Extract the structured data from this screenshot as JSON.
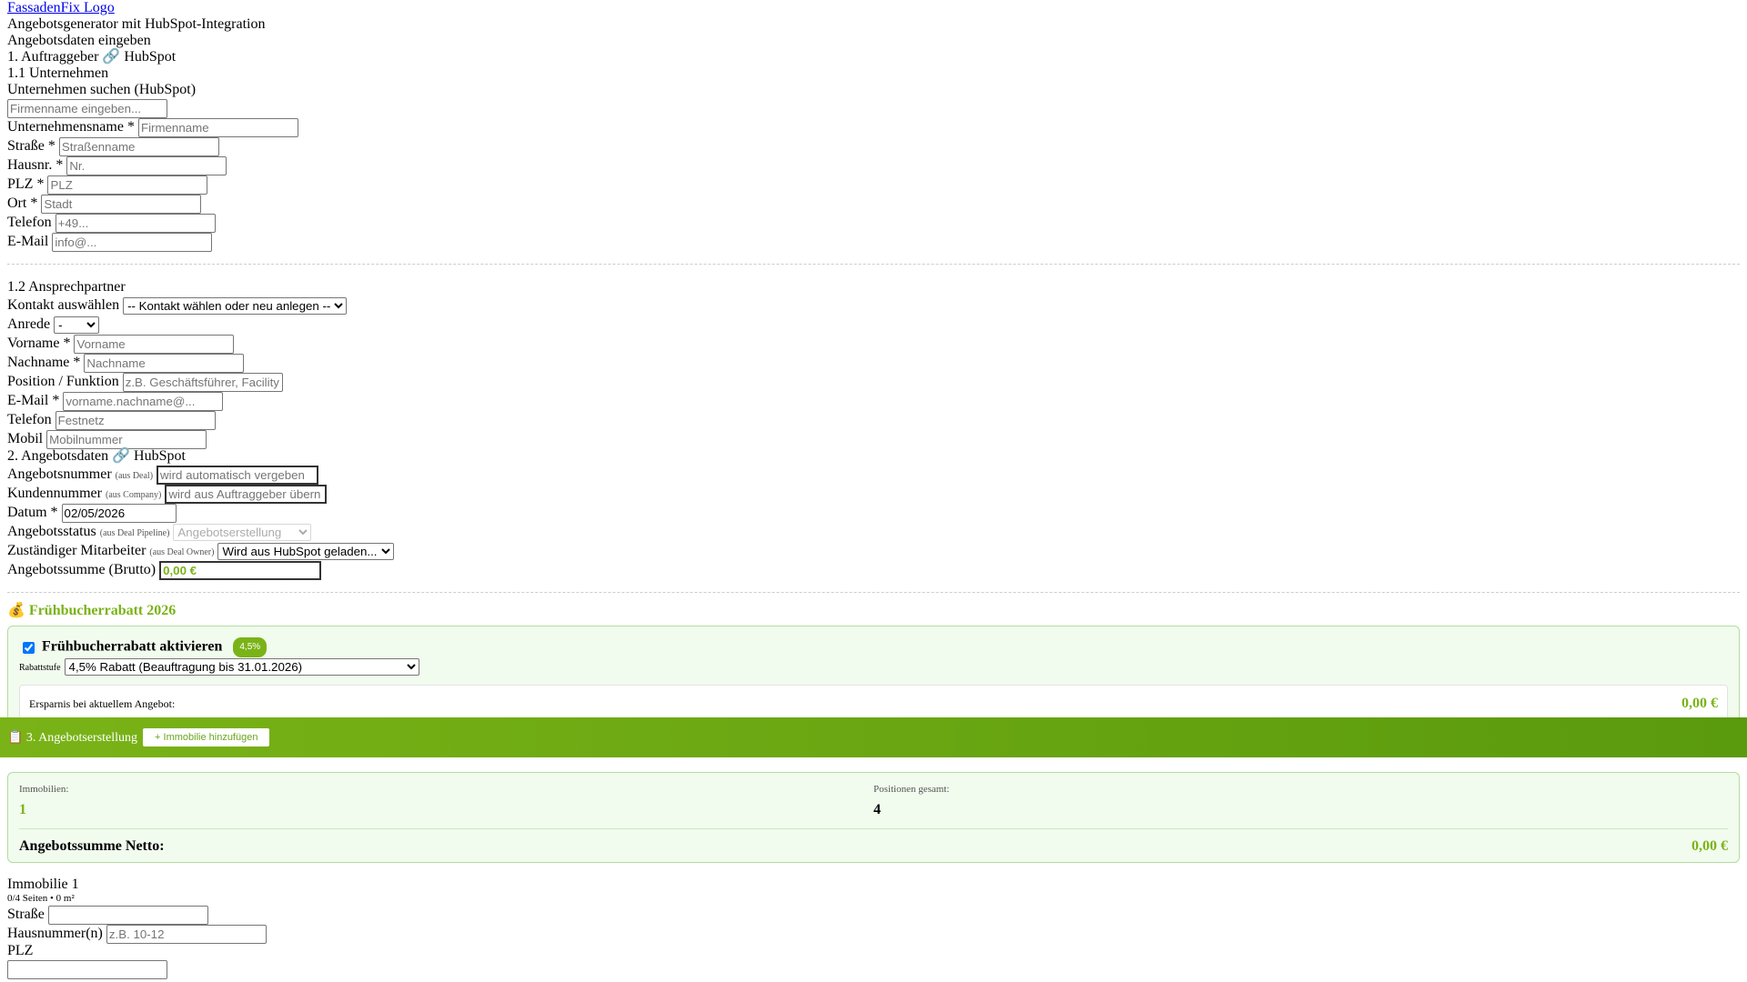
{
  "header": {
    "logo_alt": "FassadenFix Logo",
    "subtitle": "Angebotsgenerator mit HubSpot-Integration",
    "form_title": "Angebotsdaten eingeben"
  },
  "auftraggeber": {
    "heading": "1. Auftraggeber 🔗 HubSpot",
    "unternehmen_heading": "1.1 Unternehmen",
    "search_label": "Unternehmen suchen (HubSpot)",
    "search_placeholder": "Firmenname eingeben...",
    "fields": [
      {
        "label": "Unternehmensname *",
        "placeholder": "Firmenname"
      },
      {
        "label": "Straße *",
        "placeholder": "Straßenname"
      },
      {
        "label": "Hausnr. *",
        "placeholder": "Nr."
      },
      {
        "label": "PLZ *",
        "placeholder": "PLZ"
      },
      {
        "label": "Ort *",
        "placeholder": "Stadt"
      },
      {
        "label": "Telefon",
        "placeholder": "+49..."
      },
      {
        "label": "E-Mail",
        "placeholder": "info@..."
      }
    ]
  },
  "ansprechpartner": {
    "heading": "1.2 Ansprechpartner",
    "kontakt_label": "Kontakt auswählen",
    "kontakt_value": "-- Kontakt wählen oder neu anlegen --",
    "anrede_label": "Anrede",
    "anrede_value": "-",
    "fields": [
      {
        "label": "Vorname *",
        "placeholder": "Vorname"
      },
      {
        "label": "Nachname *",
        "placeholder": "Nachname"
      },
      {
        "label": "Position / Funktion",
        "placeholder": "z.B. Geschäftsführer, Facility"
      },
      {
        "label": "E-Mail *",
        "placeholder": "vorname.nachname@..."
      },
      {
        "label": "Telefon",
        "placeholder": "Festnetz"
      },
      {
        "label": "Mobil",
        "placeholder": "Mobilnummer"
      }
    ]
  },
  "angebotsdaten": {
    "heading": "2. Angebotsdaten 🔗 HubSpot",
    "angebotsnummer_label": "Angebotsnummer",
    "angebotsnummer_hint": "(aus Deal)",
    "angebotsnummer_placeholder": "wird automatisch vergeben",
    "kundennummer_label": "Kundennummer",
    "kundennummer_hint": "(aus Company)",
    "kundennummer_placeholder": "wird aus Auftraggeber übern",
    "datum_label": "Datum *",
    "datum_value": "02/05/2026",
    "status_label": "Angebotsstatus",
    "status_hint": "(aus Deal Pipeline)",
    "status_value": "Angebotserstellung",
    "mitarbeiter_label": "Zuständiger Mitarbeiter",
    "mitarbeiter_hint": "(aus Deal Owner)",
    "mitarbeiter_value": "Wird aus HubSpot geladen...",
    "summe_label": "Angebotssumme (Brutto)",
    "summe_value": "0,00 €"
  },
  "rabatt": {
    "title": "💰 Frühbucherrabatt 2026",
    "checkbox_label": "Frühbucherrabatt aktivieren",
    "badge": "4,5%",
    "stufe_label": "Rabattstufe",
    "stufe_value": "4,5% Rabatt (Beauftragung bis 31.01.2026)",
    "ersparnis_label": "Ersparnis bei aktuellem Angebot:",
    "ersparnis_value": "0,00 €"
  },
  "angebotserstellung": {
    "heading": "📋 3. Angebotserstellung",
    "add_button": "+ Immobilie hinzufügen"
  },
  "summary": {
    "immobilien_label": "Immobilien:",
    "immobilien_value": "1",
    "positionen_label": "Positionen gesamt:",
    "positionen_value": "4",
    "netto_label": "Angebotssumme Netto:",
    "netto_value": "0,00 €"
  },
  "immobilie": {
    "title": "Immobilie 1",
    "meta": "0/4 Seiten • 0 m²",
    "strasse_label": "Straße",
    "hausnummer_label": "Hausnummer(n)",
    "hausnummer_placeholder": "z.B. 10-12",
    "plz_label": "PLZ"
  },
  "colors": {
    "accent": "#7ab317",
    "accent_dark": "#5a9a0d",
    "panel_bg": "#f1fbee"
  }
}
